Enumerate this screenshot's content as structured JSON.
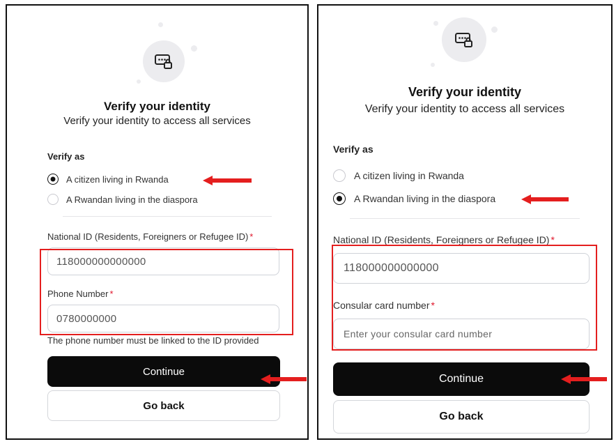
{
  "left": {
    "title": "Verify your identity",
    "subtitle": "Verify your identity to access all services",
    "verify_as_label": "Verify as",
    "options": [
      {
        "label": "A citizen living in Rwanda",
        "selected": true
      },
      {
        "label": "A Rwandan living in the diaspora",
        "selected": false
      }
    ],
    "national_id_label": "National ID (Residents, Foreigners or Refugee ID)",
    "national_id_value": "118000000000000",
    "phone_label": "Phone Number",
    "phone_value": "0780000000",
    "required_mark": "*",
    "helper_text": "The phone number must be linked to the ID provided",
    "continue_label": "Continue",
    "go_back_label": "Go back"
  },
  "right": {
    "title": "Verify your identity",
    "subtitle": "Verify your identity to access all services",
    "verify_as_label": "Verify as",
    "options": [
      {
        "label": "A citizen living in Rwanda",
        "selected": false
      },
      {
        "label": "A Rwandan living in the diaspora",
        "selected": true
      }
    ],
    "national_id_label": "National ID (Residents, Foreigners or Refugee ID)",
    "national_id_value": "118000000000000",
    "consular_label": "Consular card number",
    "consular_placeholder": "Enter your consular card number",
    "required_mark": "*",
    "continue_label": "Continue",
    "go_back_label": "Go back"
  },
  "colors": {
    "accent": "#0b0b0b",
    "required": "#e0162b",
    "annotation": "#e41e1e"
  },
  "icons": {
    "header": "id-card-lock-icon",
    "annotation": "arrow-left-icon"
  }
}
